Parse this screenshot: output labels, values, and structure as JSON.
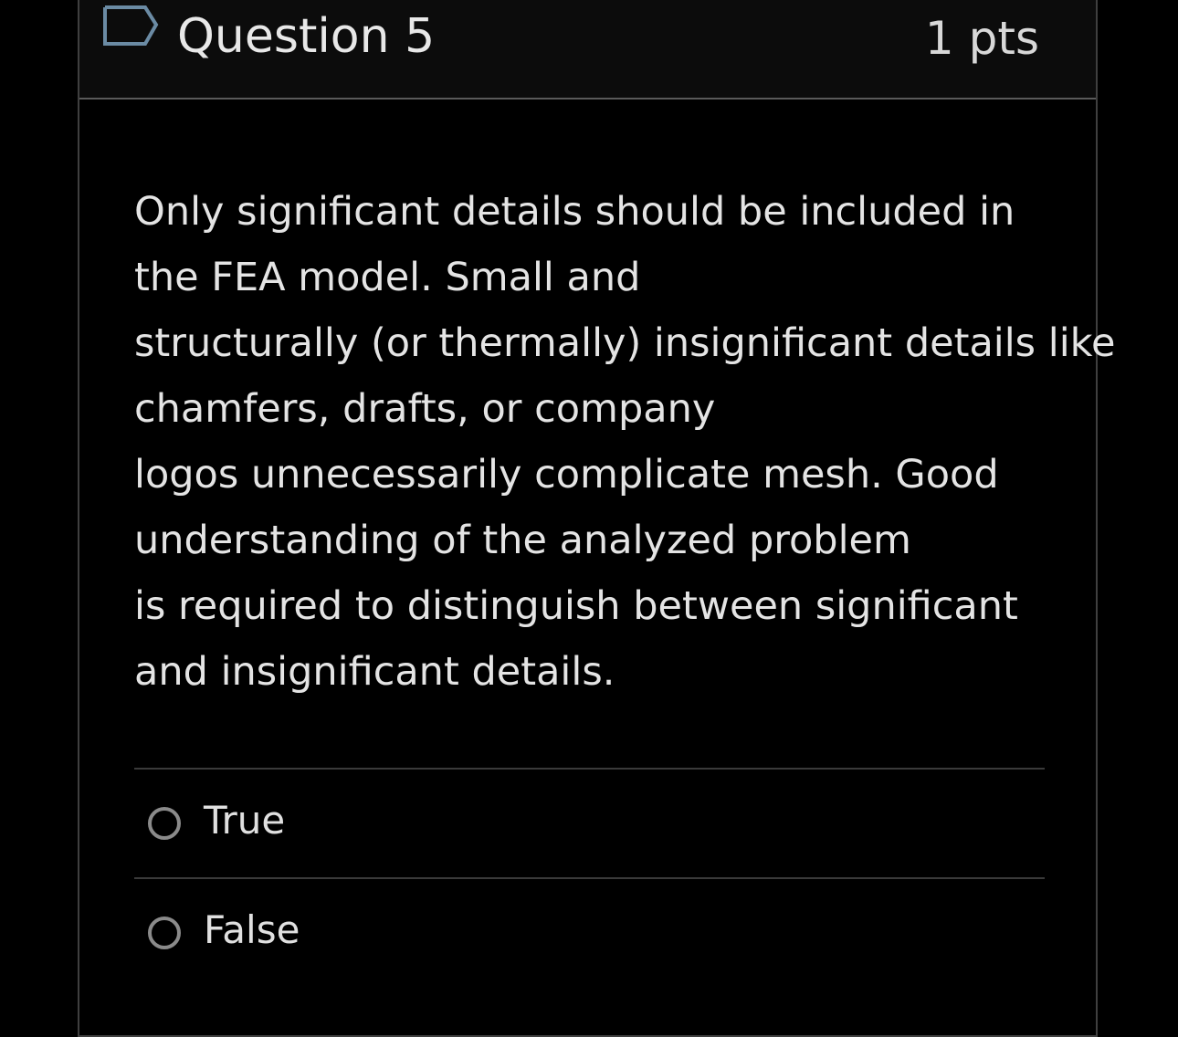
{
  "question": {
    "title": "Question 5",
    "points": "1 pts",
    "flag_icon": "flag-outline-icon",
    "text_lines": [
      "Only significant details should be included in",
      "the FEA model. Small and",
      "structurally (or thermally) insignificant details like",
      "chamfers, drafts, or company",
      "logos unnecessarily complicate mesh. Good",
      "understanding of the analyzed problem",
      "is required to distinguish between significant",
      "and insignificant details."
    ]
  },
  "answers": [
    {
      "label": "True",
      "selected": false
    },
    {
      "label": "False",
      "selected": false
    }
  ],
  "colors": {
    "background": "#000000",
    "header_background": "#0c0c0c",
    "text": "#e6e6e6",
    "border": "#3f3f3f",
    "flag_accent": "#6b8ba4"
  }
}
